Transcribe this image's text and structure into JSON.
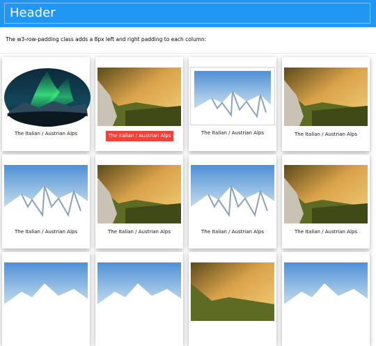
{
  "header": {
    "title": "Header"
  },
  "intro": {
    "text": "The w3-row-padding class adds a 8px left and right padding to each column:"
  },
  "cards": [
    {
      "label": "The Italian / Austrian Alps",
      "image_icon": "aurora-image"
    },
    {
      "label": "The Italian / Austrian Alps",
      "image_icon": "forest-valley-image",
      "style": "button"
    },
    {
      "label": "The Italian / Austrian Alps",
      "image_icon": "snowy-mountains-image"
    },
    {
      "label": "The Italian / Austrian Alps",
      "image_icon": "forest-valley-image"
    },
    {
      "label": "The Italian / Austrian Alps",
      "image_icon": "snowy-mountains-image"
    },
    {
      "label": "The Italian / Austrian Alps",
      "image_icon": "forest-valley-image"
    },
    {
      "label": "The Italian / Austrian Alps",
      "image_icon": "snowy-mountains-image"
    },
    {
      "label": "The Italian / Austrian Alps",
      "image_icon": "forest-valley-image"
    },
    {
      "image_icon": "snowy-mountains-image"
    },
    {
      "image_icon": "snowy-mountains-image"
    },
    {
      "image_icon": "forest-valley-image"
    },
    {
      "image_icon": "snowy-mountains-image"
    }
  ],
  "colors": {
    "header": "#2196f3",
    "button": "#f44336"
  }
}
